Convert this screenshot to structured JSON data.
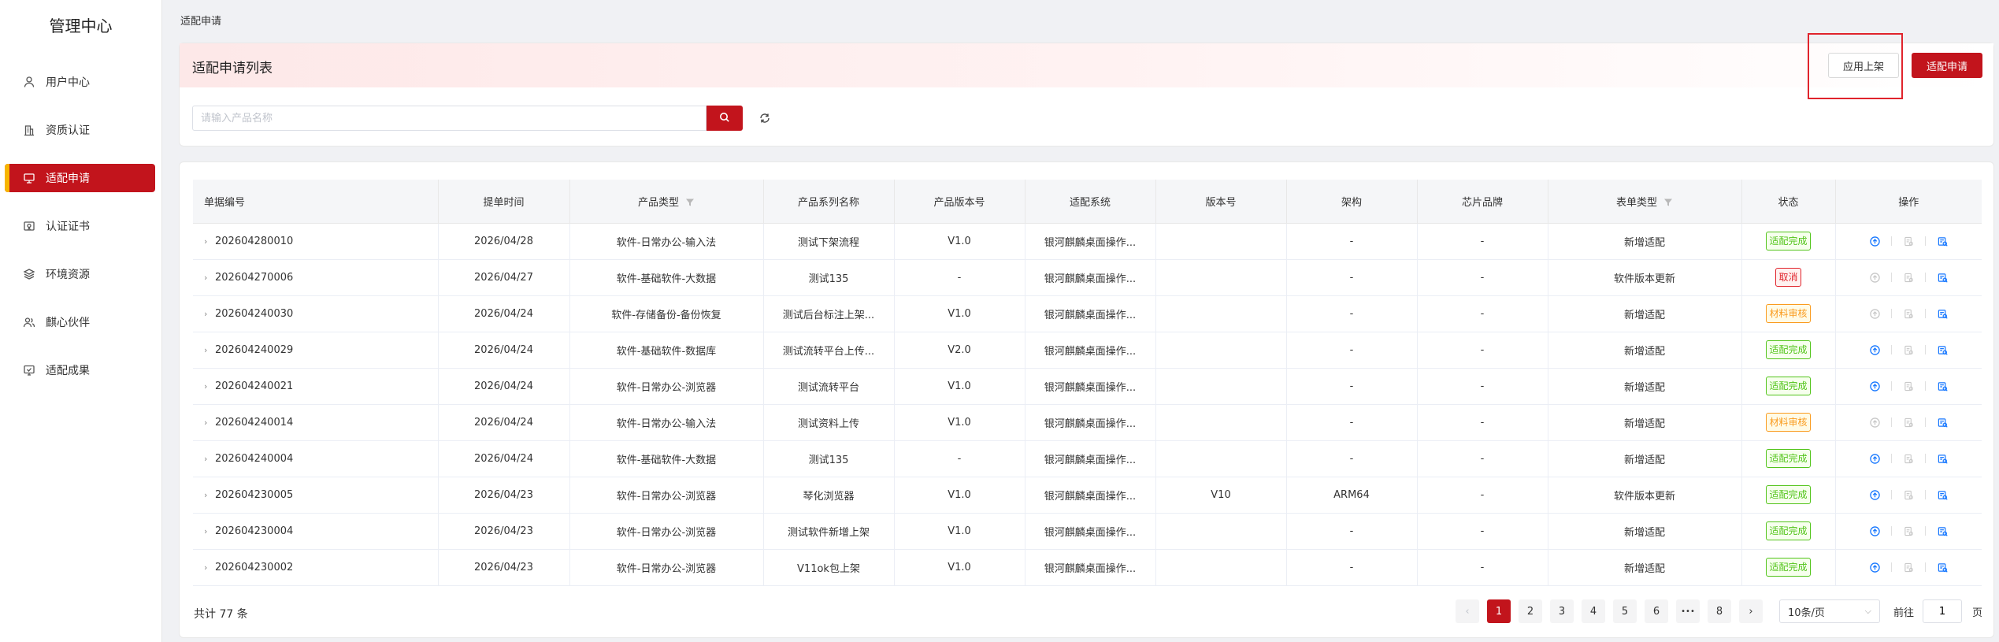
{
  "sidebar": {
    "brand": "管理中心",
    "items": [
      {
        "label": "用户中心",
        "icon": "user-icon"
      },
      {
        "label": "资质认证",
        "icon": "building-icon"
      },
      {
        "label": "适配申请",
        "icon": "monitor-icon"
      },
      {
        "label": "认证证书",
        "icon": "certificate-icon"
      },
      {
        "label": "环境资源",
        "icon": "layers-icon"
      },
      {
        "label": "麒心伙伴",
        "icon": "partners-icon"
      },
      {
        "label": "适配成果",
        "icon": "result-icon"
      }
    ],
    "active_index": 2
  },
  "breadcrumb": "适配申请",
  "header": {
    "title": "适配申请列表",
    "publish_button": "应用上架",
    "apply_button": "适配申请",
    "search_placeholder": "请输入产品名称"
  },
  "table": {
    "columns": [
      "单据编号",
      "提单时间",
      "产品类型",
      "产品系列名称",
      "产品版本号",
      "适配系统",
      "版本号",
      "架构",
      "芯片品牌",
      "表单类型",
      "状态",
      "操作"
    ],
    "rows": [
      {
        "id": "202604280010",
        "date": "2026/04/28",
        "type": "软件-日常办公-输入法",
        "series": "测试下架流程",
        "pver": "V1.0",
        "system": "银河麒麟桌面操作...",
        "ver": "",
        "arch": "-",
        "chip": "-",
        "form": "新增适配",
        "status": "适配完成",
        "status_kind": "done"
      },
      {
        "id": "202604270006",
        "date": "2026/04/27",
        "type": "软件-基础软件-大数据",
        "series": "测试135",
        "pver": "-",
        "system": "银河麒麟桌面操作...",
        "ver": "",
        "arch": "-",
        "chip": "-",
        "form": "软件版本更新",
        "status": "取消",
        "status_kind": "cancel"
      },
      {
        "id": "202604240030",
        "date": "2026/04/24",
        "type": "软件-存储备份-备份恢复",
        "series": "测试后台标注上架...",
        "pver": "V1.0",
        "system": "银河麒麟桌面操作...",
        "ver": "",
        "arch": "-",
        "chip": "-",
        "form": "新增适配",
        "status": "材料审核",
        "status_kind": "review"
      },
      {
        "id": "202604240029",
        "date": "2026/04/24",
        "type": "软件-基础软件-数据库",
        "series": "测试流转平台上传...",
        "pver": "V2.0",
        "system": "银河麒麟桌面操作...",
        "ver": "",
        "arch": "-",
        "chip": "-",
        "form": "新增适配",
        "status": "适配完成",
        "status_kind": "done"
      },
      {
        "id": "202604240021",
        "date": "2026/04/24",
        "type": "软件-日常办公-浏览器",
        "series": "测试流转平台",
        "pver": "V1.0",
        "system": "银河麒麟桌面操作...",
        "ver": "",
        "arch": "-",
        "chip": "-",
        "form": "新增适配",
        "status": "适配完成",
        "status_kind": "done"
      },
      {
        "id": "202604240014",
        "date": "2026/04/24",
        "type": "软件-日常办公-输入法",
        "series": "测试资料上传",
        "pver": "V1.0",
        "system": "银河麒麟桌面操作...",
        "ver": "",
        "arch": "-",
        "chip": "-",
        "form": "新增适配",
        "status": "材料审核",
        "status_kind": "review"
      },
      {
        "id": "202604240004",
        "date": "2026/04/24",
        "type": "软件-基础软件-大数据",
        "series": "测试135",
        "pver": "-",
        "system": "银河麒麟桌面操作...",
        "ver": "",
        "arch": "-",
        "chip": "-",
        "form": "新增适配",
        "status": "适配完成",
        "status_kind": "done"
      },
      {
        "id": "202604230005",
        "date": "2026/04/23",
        "type": "软件-日常办公-浏览器",
        "series": "琴化浏览器",
        "pver": "V1.0",
        "system": "银河麒麟桌面操作...",
        "ver": "V10",
        "arch": "ARM64",
        "chip": "-",
        "form": "软件版本更新",
        "status": "适配完成",
        "status_kind": "done"
      },
      {
        "id": "202604230004",
        "date": "2026/04/23",
        "type": "软件-日常办公-浏览器",
        "series": "测试软件新增上架",
        "pver": "V1.0",
        "system": "银河麒麟桌面操作...",
        "ver": "",
        "arch": "-",
        "chip": "-",
        "form": "新增适配",
        "status": "适配完成",
        "status_kind": "done"
      },
      {
        "id": "202604230002",
        "date": "2026/04/23",
        "type": "软件-日常办公-浏览器",
        "series": "V11ok包上架",
        "pver": "V1.0",
        "system": "银河麒麟桌面操作...",
        "ver": "",
        "arch": "-",
        "chip": "-",
        "form": "新增适配",
        "status": "适配完成",
        "status_kind": "done"
      }
    ]
  },
  "footer": {
    "total": "共计 77 条",
    "pages": [
      "1",
      "2",
      "3",
      "4",
      "5",
      "6",
      "•••",
      "8"
    ],
    "current_page": "1",
    "page_size": "10条/页",
    "goto_prefix": "前往",
    "goto_value": "1",
    "goto_suffix": "页"
  },
  "colors": {
    "brand": "#c2141c",
    "done": "#52c41a",
    "cancel": "#e0242c",
    "review": "#fa9b1e"
  }
}
